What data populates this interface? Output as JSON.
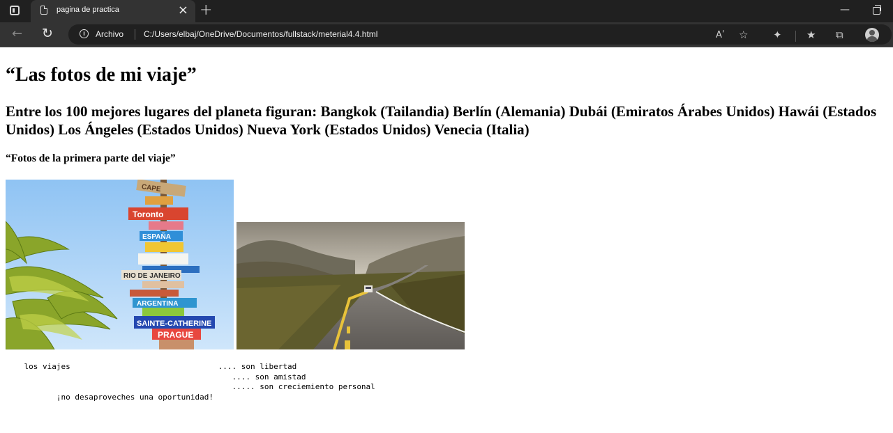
{
  "browser": {
    "tab_title": "pagina de practica",
    "tab_close": "×",
    "new_tab": "+",
    "site_info_label": "Archivo",
    "url": "C:/Users/elbaj/OneDrive/Documentos/fullstack/meterial4.4.html",
    "read_aloud_glyph": "Aʹ"
  },
  "page": {
    "heading": "“Las fotos de mi viaje”",
    "subheading": "Entre los 100 mejores lugares del planeta figuran: Bangkok (Tailandia) Berlín (Alemania) Dubái (Emiratos Árabes Unidos) Hawái (Estados Unidos) Los Ángeles (Estados Unidos) Nueva York (Estados Unidos) Venecia (Italia)",
    "section_title": "“Fotos de la primera parte del viaje”",
    "images": [
      {
        "name": "signpost-photo",
        "signs": [
          "CAPE",
          "Toronto",
          "ESPAÑA",
          "RIO DE JANEIRO",
          "ARGENTINA",
          "SAINTE-CATHERINE",
          "PRAGUE"
        ]
      },
      {
        "name": "road-photo"
      }
    ],
    "preformatted_lines": [
      "    los viajes                                .... son libertad",
      "                                                 .... son amistad",
      "                                                 ..... son creciemiento personal",
      "           ¡no desaproveches una oportunidad!"
    ]
  },
  "colors": {
    "chrome_dark": "#202020",
    "toolbar": "#333333",
    "page_bg": "#ffffff",
    "text": "#000000"
  }
}
